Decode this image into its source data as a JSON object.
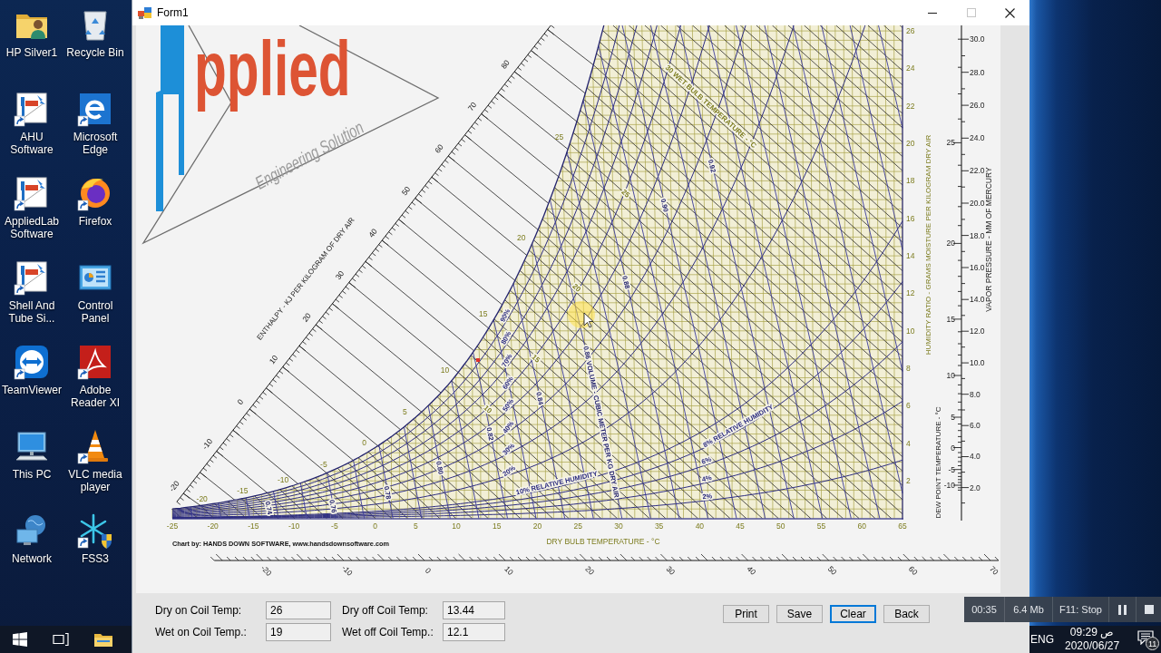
{
  "desktop": {
    "icons": [
      {
        "kind": "folder-person",
        "label": "HP Silver1",
        "shortcut": false
      },
      {
        "kind": "recycle-bin",
        "label": "Recycle Bin",
        "shortcut": false
      },
      {
        "kind": "logo-tile",
        "label": "AHU Software",
        "shortcut": true
      },
      {
        "kind": "e-tile",
        "label": "Microsoft Edge",
        "shortcut": true
      },
      {
        "kind": "logo-tile",
        "label": "AppliedLab Software",
        "shortcut": true
      },
      {
        "kind": "flame-globe",
        "label": "Firefox",
        "shortcut": true
      },
      {
        "kind": "logo-tile",
        "label": "Shell And Tube Si...",
        "shortcut": true
      },
      {
        "kind": "panel-window",
        "label": "Control Panel",
        "shortcut": false
      },
      {
        "kind": "arrow-circle",
        "label": "TeamViewer",
        "shortcut": true
      },
      {
        "kind": "swirl-tile",
        "label": "Adobe Reader XI",
        "shortcut": true
      },
      {
        "kind": "computer",
        "label": "This PC",
        "shortcut": false
      },
      {
        "kind": "cone",
        "label": "VLC media player",
        "shortcut": true
      },
      {
        "kind": "globe-monitor",
        "label": "Network",
        "shortcut": false
      },
      {
        "kind": "snowflake-shield",
        "label": "FSS3",
        "shortcut": true
      }
    ]
  },
  "window": {
    "title": "Form1",
    "controls": [
      {
        "kind": "minimize",
        "disabled": false
      },
      {
        "kind": "maximize",
        "disabled": true
      },
      {
        "kind": "close",
        "disabled": false
      }
    ]
  },
  "chart": {
    "logo": {
      "name": "pplied",
      "tagline": "Engineering Solution"
    },
    "enthalpy_axis": {
      "title": "ENTHALPY - KJ PER KILOGRAM OF DRY AIR",
      "ticks": [
        "80",
        "70",
        "60",
        "50",
        "40",
        "30",
        "20",
        "10",
        "0",
        "-10",
        "-20"
      ]
    },
    "saturation_labels": [
      "25",
      "20",
      "15",
      "10",
      "5",
      "0",
      "-5",
      "-10",
      "-15",
      "-20"
    ],
    "wet_bulb_labels": [
      "30 WET BULB TEMPERATURE - °C",
      "25",
      "20",
      "15",
      "10"
    ],
    "rh_labels": [
      "10% RELATIVE HUMIDITY",
      "8% RELATIVE HUMIDITY",
      "2%",
      "4%",
      "6%",
      "20%",
      "30%",
      "40%",
      "50%",
      "60%",
      "70%",
      "80%",
      "90%"
    ],
    "volume_labels": [
      "0.74",
      "0.76",
      "0.78",
      "0.80",
      "0.82",
      "0.84",
      "0.86 VOLUME - CUBIC METER PER KG DRY AIR",
      "0.88",
      "0.90",
      "0.92"
    ],
    "dry_bulb_axis": {
      "title": "DRY BULB TEMPERATURE - °C",
      "ticks": [
        "-25",
        "-20",
        "-15",
        "-10",
        "-5",
        "0",
        "5",
        "10",
        "15",
        "20",
        "25",
        "30",
        "35",
        "40",
        "45",
        "50",
        "55",
        "60",
        "65"
      ]
    },
    "credit": "Chart by: HANDS DOWN SOFTWARE, www.handsdownsoftware.com",
    "bottom_scale_ticks": [
      "-20",
      "-10",
      "0",
      "10",
      "20",
      "30",
      "40",
      "50",
      "60",
      "70"
    ],
    "humidity_ratio_axis": {
      "title": "HUMIDITY RATIO - GRAMS MOISTURE PER KILOGRAM DRY AIR",
      "ticks": [
        "26",
        "24",
        "22",
        "20",
        "18",
        "16",
        "14",
        "12",
        "10",
        "8",
        "6",
        "4",
        "2"
      ]
    },
    "dew_point_axis": {
      "title": "DEW POINT TEMPERATURE - °C",
      "ticks": [
        "25",
        "20",
        "15",
        "10",
        "5",
        "0",
        "-5",
        "-10"
      ]
    },
    "vapor_pressure_axis": {
      "title": "VAPOR PRESSURE - MM OF MERCURY",
      "ticks": [
        "30.0",
        "28.0",
        "26.0",
        "24.0",
        "22.0",
        "20.0",
        "18.0",
        "16.0",
        "14.0",
        "12.0",
        "10.0",
        "8.0",
        "6.0",
        "4.0",
        "2.0"
      ]
    }
  },
  "form": {
    "fields": [
      {
        "label": "Dry on Coil Temp:",
        "value": "26"
      },
      {
        "label": "Dry off Coil Temp:",
        "value": "13.44"
      },
      {
        "label": "Wet on Coil Temp.:",
        "value": "19"
      },
      {
        "label": "Wet off Coil Temp.:",
        "value": "12.1"
      }
    ],
    "buttons": [
      {
        "label": "Print",
        "focused": false
      },
      {
        "label": "Save",
        "focused": false
      },
      {
        "label": "Clear",
        "focused": true
      },
      {
        "label": "Back",
        "focused": false
      }
    ]
  },
  "recorder": {
    "elapsed": "00:35",
    "file_size": "6.4 Mb",
    "stop_hint": "F11: Stop"
  },
  "taskbar": {
    "language": "ENG",
    "time": "09:29 ص",
    "date": "2020/06/27",
    "notifications": "11"
  }
}
